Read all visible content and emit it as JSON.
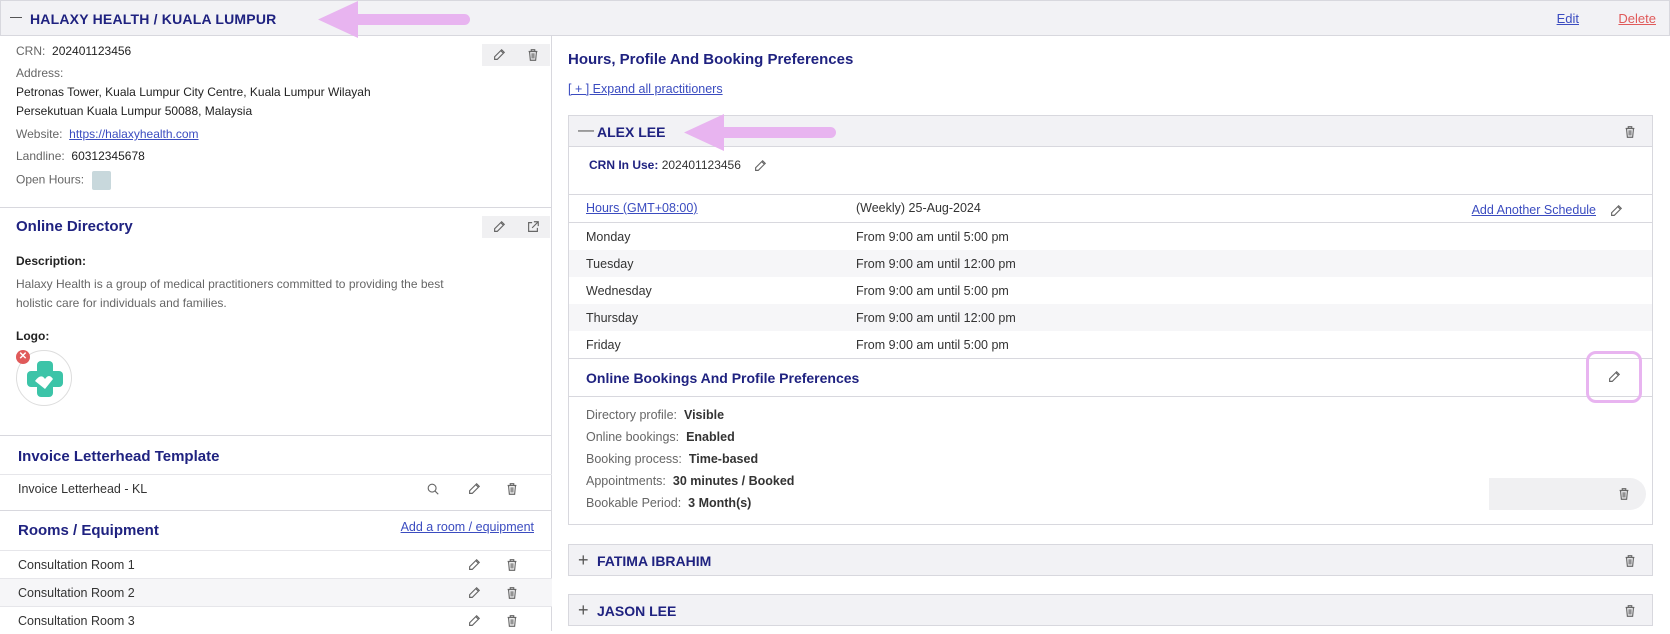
{
  "header": {
    "title": "HALAXY HEALTH / KUALA LUMPUR",
    "edit_label": "Edit",
    "delete_label": "Delete"
  },
  "clinic": {
    "crn_label": "CRN:",
    "crn_value": "202401123456",
    "address_label": "Address:",
    "address_line1": "Petronas Tower, Kuala Lumpur City Centre, Kuala Lumpur Wilayah",
    "address_line2": "Persekutuan Kuala Lumpur 50088, Malaysia",
    "website_label": "Website:",
    "website_value": "https://halaxyhealth.com",
    "landline_label": "Landline:",
    "landline_value": "60312345678",
    "open_hours_label": "Open Hours:"
  },
  "online_directory": {
    "title": "Online Directory",
    "description_label": "Description:",
    "description_line1": "Halaxy Health is a group of medical practitioners committed to providing the best",
    "description_line2": "holistic care for individuals and families.",
    "logo_label": "Logo:"
  },
  "invoice": {
    "title": "Invoice Letterhead Template",
    "item": "Invoice Letterhead - KL"
  },
  "rooms": {
    "title": "Rooms / Equipment",
    "add_label": "Add a room / equipment",
    "items": [
      "Consultation Room 1",
      "Consultation Room 2",
      "Consultation Room 3"
    ]
  },
  "preferences": {
    "title": "Hours, Profile And Booking Preferences",
    "expand_label": "[ + ] Expand all practitioners"
  },
  "practitioner": {
    "name": "ALEX LEE",
    "crn_label": "CRN In Use:",
    "crn_value": "202401123456",
    "hours_link": "Hours (GMT+08:00)",
    "schedule_label": "(Weekly) 25-Aug-2024",
    "add_schedule": "Add Another Schedule",
    "schedule": [
      {
        "day": "Monday",
        "time": "From 9:00 am until 5:00 pm"
      },
      {
        "day": "Tuesday",
        "time": "From 9:00 am until 12:00 pm"
      },
      {
        "day": "Wednesday",
        "time": "From 9:00 am until 5:00 pm"
      },
      {
        "day": "Thursday",
        "time": "From 9:00 am until 12:00 pm"
      },
      {
        "day": "Friday",
        "time": "From 9:00 am until 5:00 pm"
      }
    ],
    "booking_title": "Online Bookings And Profile Preferences",
    "prefs": [
      {
        "label": "Directory profile:",
        "value": "Visible"
      },
      {
        "label": "Online bookings:",
        "value": "Enabled"
      },
      {
        "label": "Booking process:",
        "value": "Time-based"
      },
      {
        "label": "Appointments:",
        "value": "30 minutes / Booked"
      },
      {
        "label": "Bookable Period:",
        "value": "3 Month(s)"
      }
    ]
  },
  "other_practitioners": [
    "FATIMA IBRAHIM",
    "JASON LEE"
  ],
  "colors": {
    "accent": "#1f2280",
    "link": "#3b4cc0",
    "delete": "#e05a5a",
    "annotation": "#e8b4f0",
    "logo": "#3cc4a8"
  }
}
